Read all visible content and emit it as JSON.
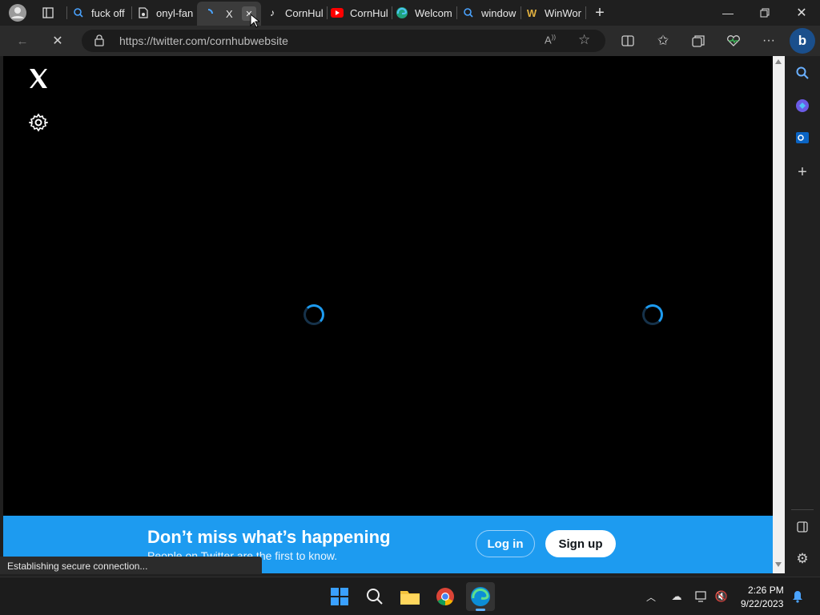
{
  "tabs": [
    {
      "label": "fuck off",
      "icon": "search-icon"
    },
    {
      "label": "onyl-fan",
      "icon": "page-icon"
    },
    {
      "label": "X",
      "icon": "loading-icon"
    },
    {
      "label": "CornHul",
      "icon": "tiktok-icon"
    },
    {
      "label": "CornHul",
      "icon": "youtube-icon"
    },
    {
      "label": "Welcom",
      "icon": "edge-icon"
    },
    {
      "label": "window",
      "icon": "search-icon"
    },
    {
      "label": "WinWor",
      "icon": "winworld-icon"
    }
  ],
  "address": {
    "url": "https://twitter.com/cornhubwebsite"
  },
  "page": {
    "banner_title": "Don’t miss what’s happening",
    "banner_subtitle": "People on Twitter are the first to know.",
    "login_label": "Log in",
    "signup_label": "Sign up",
    "logo_glyph": "X"
  },
  "status_text": "Establishing secure connection...",
  "taskbar": {
    "time": "2:26 PM",
    "date": "9/22/2023"
  },
  "colors": {
    "twitter_blue": "#1d9bf0",
    "browser_dark": "#202020"
  }
}
